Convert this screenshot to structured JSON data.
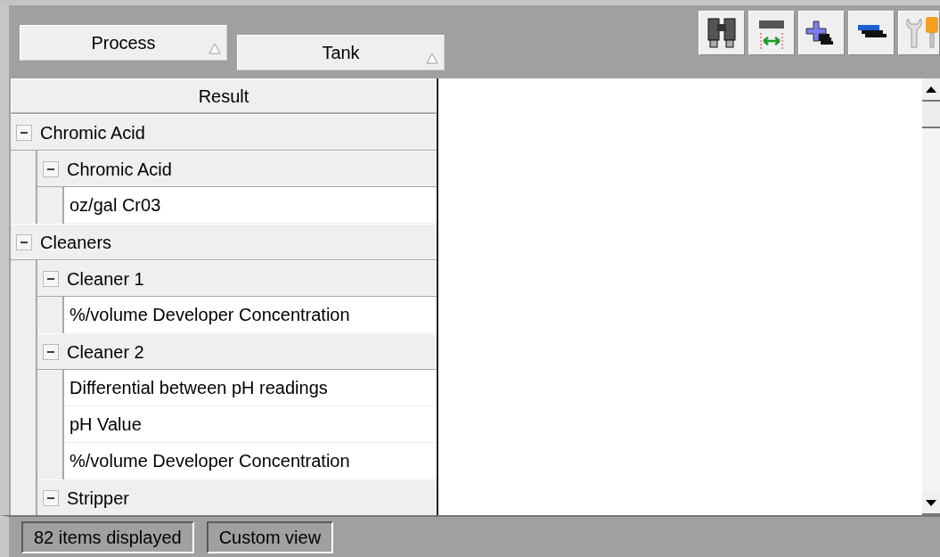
{
  "group_by": [
    {
      "label": "Process",
      "ascending": true
    },
    {
      "label": "Tank",
      "ascending": true
    }
  ],
  "toolbar": [
    {
      "kind": "find"
    },
    {
      "kind": "autofit"
    },
    {
      "kind": "expand"
    },
    {
      "kind": "collapse"
    },
    {
      "kind": "settings"
    }
  ],
  "tree": {
    "column": "Result",
    "items": [
      {
        "label": "Chromic Acid",
        "expanded": true,
        "children": [
          {
            "label": "Chromic Acid",
            "expanded": true,
            "children": [
              {
                "label": "oz/gal Cr03"
              }
            ]
          }
        ]
      },
      {
        "label": "Cleaners",
        "expanded": true,
        "children": [
          {
            "label": "Cleaner 1",
            "expanded": true,
            "children": [
              {
                "label": "%/volume Developer Concentration"
              }
            ]
          },
          {
            "label": "Cleaner 2",
            "expanded": true,
            "children": [
              {
                "label": "Differential between pH readings"
              },
              {
                "label": "pH Value"
              },
              {
                "label": "%/volume Developer Concentration"
              }
            ]
          },
          {
            "label": "Stripper",
            "expanded": true
          }
        ]
      }
    ]
  },
  "status_bar": [
    "82 items displayed",
    "Custom view"
  ]
}
